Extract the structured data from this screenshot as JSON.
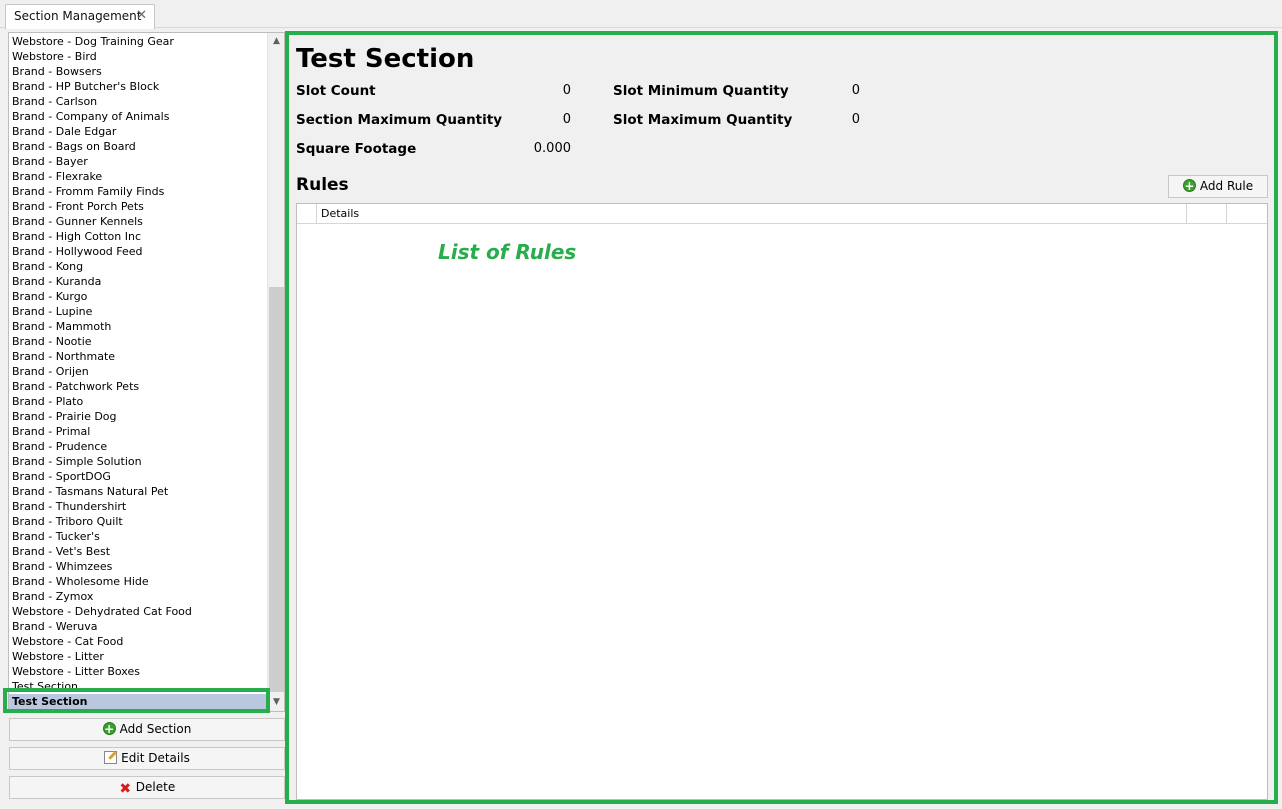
{
  "tab": {
    "title": "Section Management",
    "close": "✕"
  },
  "sections": [
    "Webstore - Dog Training Gear",
    "Webstore - Bird",
    "Brand - Bowsers",
    "Brand - HP Butcher's Block",
    "Brand - Carlson",
    "Brand - Company of Animals",
    "Brand - Dale Edgar",
    "Brand - Bags on Board",
    "Brand - Bayer",
    "Brand - Flexrake",
    "Brand - Fromm Family Finds",
    "Brand - Front Porch Pets",
    "Brand - Gunner Kennels",
    "Brand - High Cotton Inc",
    "Brand - Hollywood Feed",
    "Brand - Kong",
    "Brand - Kuranda",
    "Brand - Kurgo",
    "Brand - Lupine",
    "Brand - Mammoth",
    "Brand - Nootie",
    "Brand - Northmate",
    "Brand - Orijen",
    "Brand - Patchwork Pets",
    "Brand - Plato",
    "Brand - Prairie Dog",
    "Brand - Primal",
    "Brand - Prudence",
    "Brand - Simple Solution",
    "Brand - SportDOG",
    "Brand - Tasmans Natural Pet",
    "Brand - Thundershirt",
    "Brand - Triboro Quilt",
    "Brand - Tucker's",
    "Brand - Vet's Best",
    "Brand - Whimzees",
    "Brand - Wholesome Hide",
    "Brand - Zymox",
    "Webstore - Dehydrated Cat Food",
    "Brand - Weruva",
    "Webstore - Cat Food",
    "Webstore - Litter",
    "Webstore - Litter Boxes",
    "Test Section",
    "Test Section"
  ],
  "selected_index": 44,
  "buttons": {
    "add_section": "Add Section",
    "edit_details": "Edit Details",
    "delete": "Delete"
  },
  "detail": {
    "title": "Test Section",
    "slot_count_label": "Slot Count",
    "slot_count": "0",
    "slot_min_label": "Slot Minimum Quantity",
    "slot_min": "0",
    "section_max_label": "Section Maximum Quantity",
    "section_max": "0",
    "slot_max_label": "Slot Maximum Quantity",
    "slot_max": "0",
    "sqft_label": "Square Footage",
    "sqft": "0.000"
  },
  "rules": {
    "title": "Rules",
    "add_rule": "Add Rule",
    "details_col": "Details",
    "annotation": "List of Rules"
  },
  "colors": {
    "highlight": "#27ad4b",
    "selection": "#b9c8de"
  }
}
